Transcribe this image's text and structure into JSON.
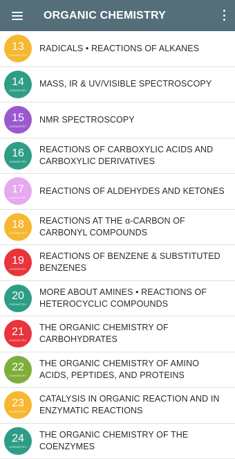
{
  "header": {
    "title": "ORGANIC CHEMISTRY"
  },
  "items": [
    {
      "number": "13",
      "sub": "CHEMISTRY",
      "label": "RADICALS • REACTIONS OF ALKANES",
      "color": "#f7b731"
    },
    {
      "number": "14",
      "sub": "CHEMISTRY",
      "label": "MASS, IR & UV/VISIBLE SPECTROSCOPY",
      "color": "#2e9d86"
    },
    {
      "number": "15",
      "sub": "CHEMISTRY",
      "label": "NMR SPECTROSCOPY",
      "color": "#9b59d0"
    },
    {
      "number": "16",
      "sub": "CHEMISTRY",
      "label": "REACTIONS OF CARBOXYLIC ACIDS AND CARBOXYLIC DERIVATIVES",
      "color": "#2e9d86"
    },
    {
      "number": "17",
      "sub": "CHEMISTRY",
      "label": "REACTIONS OF ALDEHYDES AND KETONES",
      "color": "#e6a8ef"
    },
    {
      "number": "18",
      "sub": "CHEMISTRY",
      "label": "REACTIONS AT THE α-CARBON OF CARBONYL COMPOUNDS",
      "color": "#f7b731"
    },
    {
      "number": "19",
      "sub": "CHEMISTRY",
      "label": "REACTIONS OF BENZENE & SUBSTITUTED BENZENES",
      "color": "#e8343a"
    },
    {
      "number": "20",
      "sub": "CHEMISTRY",
      "label": "MORE ABOUT AMINES • REACTIONS OF HETEROCYCLIC COMPOUNDS",
      "color": "#2e9d86"
    },
    {
      "number": "21",
      "sub": "CHEMISTRY",
      "label": "THE ORGANIC CHEMISTRY OF CARBOHYDRATES",
      "color": "#e8343a"
    },
    {
      "number": "22",
      "sub": "CHEMISTRY",
      "label": "THE ORGANIC CHEMISTRY OF AMINO ACIDS, PEPTIDES, AND PROTEINS",
      "color": "#7fad3a"
    },
    {
      "number": "23",
      "sub": "CHEMISTRY",
      "label": "CATALYSIS IN ORGANIC REACTION AND IN ENZYMATIC REACTIONS",
      "color": "#f7b731"
    },
    {
      "number": "24",
      "sub": "CHEMISTRY",
      "label": "THE ORGANIC CHEMISTRY OF THE COENZYMES",
      "color": "#2e9d86"
    }
  ]
}
